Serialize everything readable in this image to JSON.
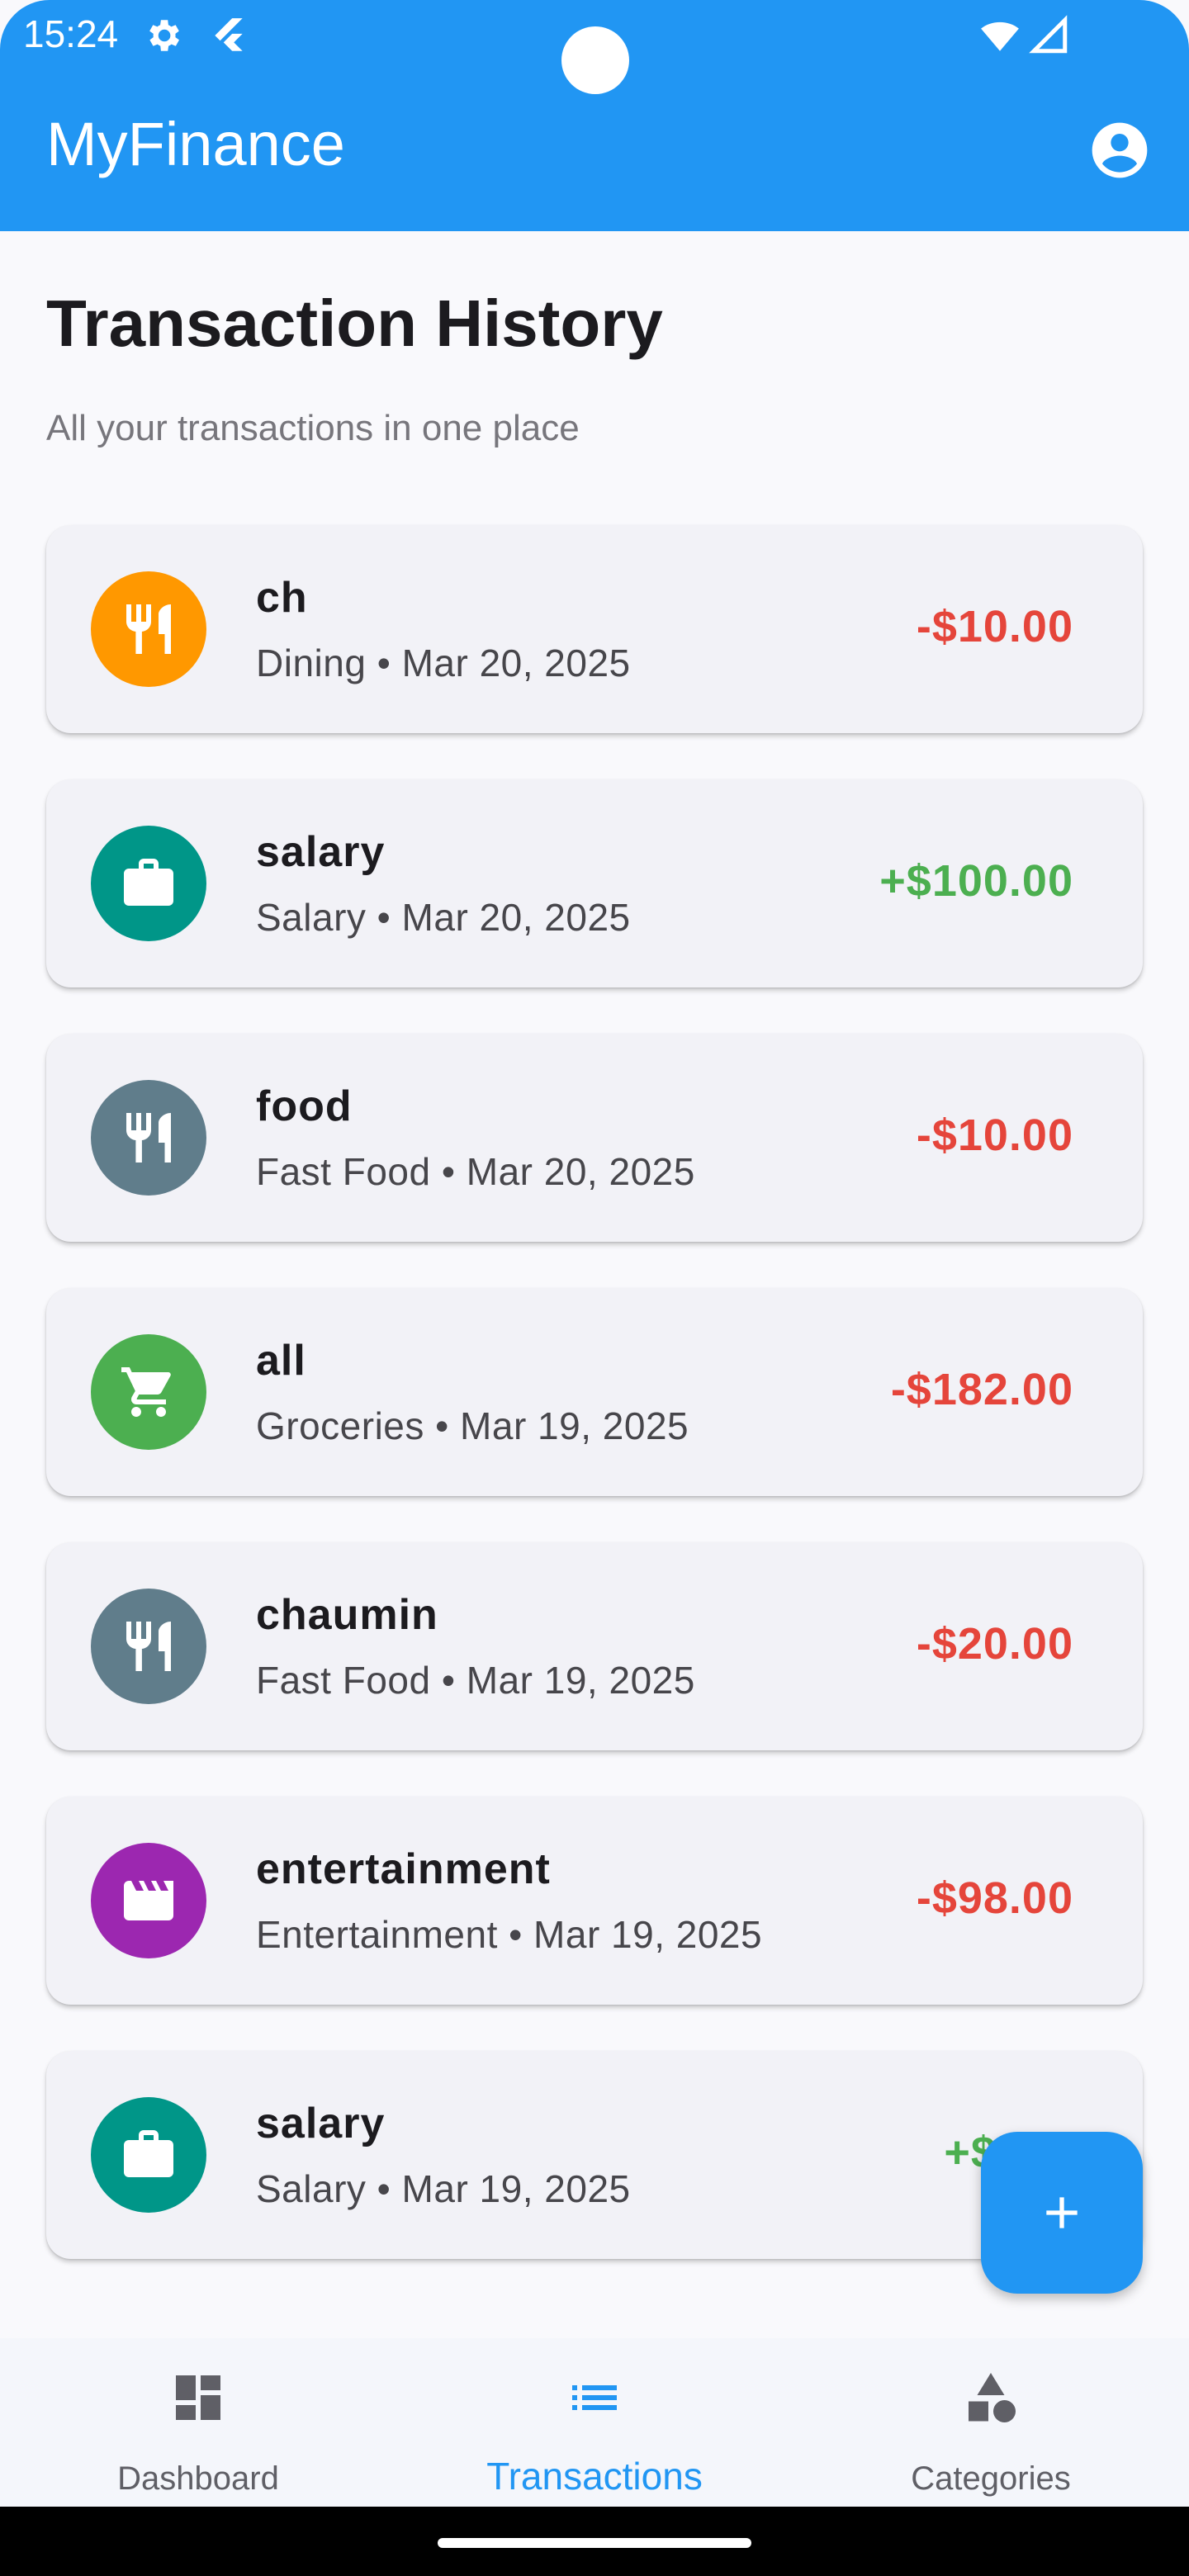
{
  "status_bar": {
    "time": "15:24"
  },
  "app_bar": {
    "title": "MyFinance",
    "account_icon": "account-circle-icon"
  },
  "page": {
    "title": "Transaction History",
    "subtitle": "All your transactions in one place"
  },
  "transactions": [
    {
      "name": "ch",
      "meta": "Dining • Mar 20, 2025",
      "amount": "-$10.00",
      "type": "expense",
      "icon": "restaurant-icon",
      "color": "#ff9800"
    },
    {
      "name": "salary",
      "meta": "Salary • Mar 20, 2025",
      "amount": "+$100.00",
      "type": "income",
      "icon": "briefcase-icon",
      "color": "#009688"
    },
    {
      "name": "food",
      "meta": "Fast Food • Mar 20, 2025",
      "amount": "-$10.00",
      "type": "expense",
      "icon": "restaurant-icon",
      "color": "#607d8b"
    },
    {
      "name": "all",
      "meta": "Groceries • Mar 19, 2025",
      "amount": "-$182.00",
      "type": "expense",
      "icon": "shopping-cart-icon",
      "color": "#4caf50"
    },
    {
      "name": "chaumin",
      "meta": "Fast Food • Mar 19, 2025",
      "amount": "-$20.00",
      "type": "expense",
      "icon": "restaurant-icon",
      "color": "#607d8b"
    },
    {
      "name": "entertainment",
      "meta": "Entertainment • Mar 19, 2025",
      "amount": "-$98.00",
      "type": "expense",
      "icon": "movie-clapper-icon",
      "color": "#9c27b0"
    },
    {
      "name": "salary",
      "meta": "Salary • Mar 19, 2025",
      "amount": "+$500",
      "type": "income",
      "icon": "briefcase-icon",
      "color": "#009688"
    }
  ],
  "fab": {
    "icon": "add-icon"
  },
  "bottom_nav": [
    {
      "label": "Dashboard",
      "icon": "dashboard-icon",
      "active": false
    },
    {
      "label": "Transactions",
      "icon": "list-icon",
      "active": true
    },
    {
      "label": "Categories",
      "icon": "categories-icon",
      "active": false
    }
  ],
  "colors": {
    "primary": "#2196f3",
    "expense": "#e5453b",
    "income": "#4caf50"
  }
}
